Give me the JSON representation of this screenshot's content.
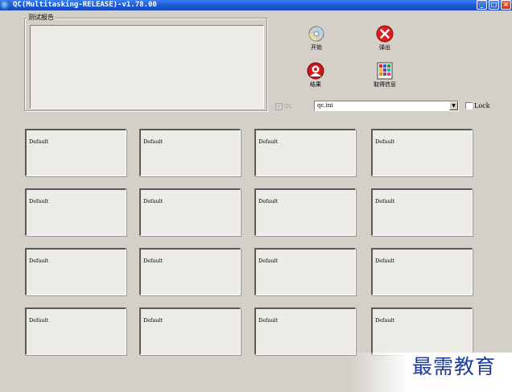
{
  "window": {
    "title": "QC(Multitasking-RELEASE)-v1.78.00",
    "minimize_glyph": "_",
    "maximize_glyph": "□",
    "close_glyph": "×"
  },
  "report_group": {
    "label": "测试报告"
  },
  "qc_checkbox": {
    "label": "QC",
    "checked": true,
    "enabled": false
  },
  "toolbar": {
    "start": {
      "label": "开始",
      "icon": "cd-disc-icon"
    },
    "eject": {
      "label": "弹出",
      "icon": "red-x-icon"
    },
    "result": {
      "label": "结果",
      "icon": "result-icon"
    },
    "get_info": {
      "label": "取得信息",
      "icon": "info-grid-icon"
    }
  },
  "config_combo": {
    "value": "qc.ini",
    "arrow": "▼"
  },
  "lock_checkbox": {
    "label": "Lock",
    "checked": false
  },
  "panels": [
    "Default",
    "Default",
    "Default",
    "Default",
    "Default",
    "Default",
    "Default",
    "Default",
    "Default",
    "Default",
    "Default",
    "Default",
    "Default",
    "Default",
    "Default",
    "Default"
  ],
  "watermark": {
    "text": "最需教育"
  },
  "colors": {
    "titlebar": "#1f5fd8",
    "face": "#d4d0c8",
    "panel": "#ecebe8",
    "watermark": "#1b3d9a"
  }
}
